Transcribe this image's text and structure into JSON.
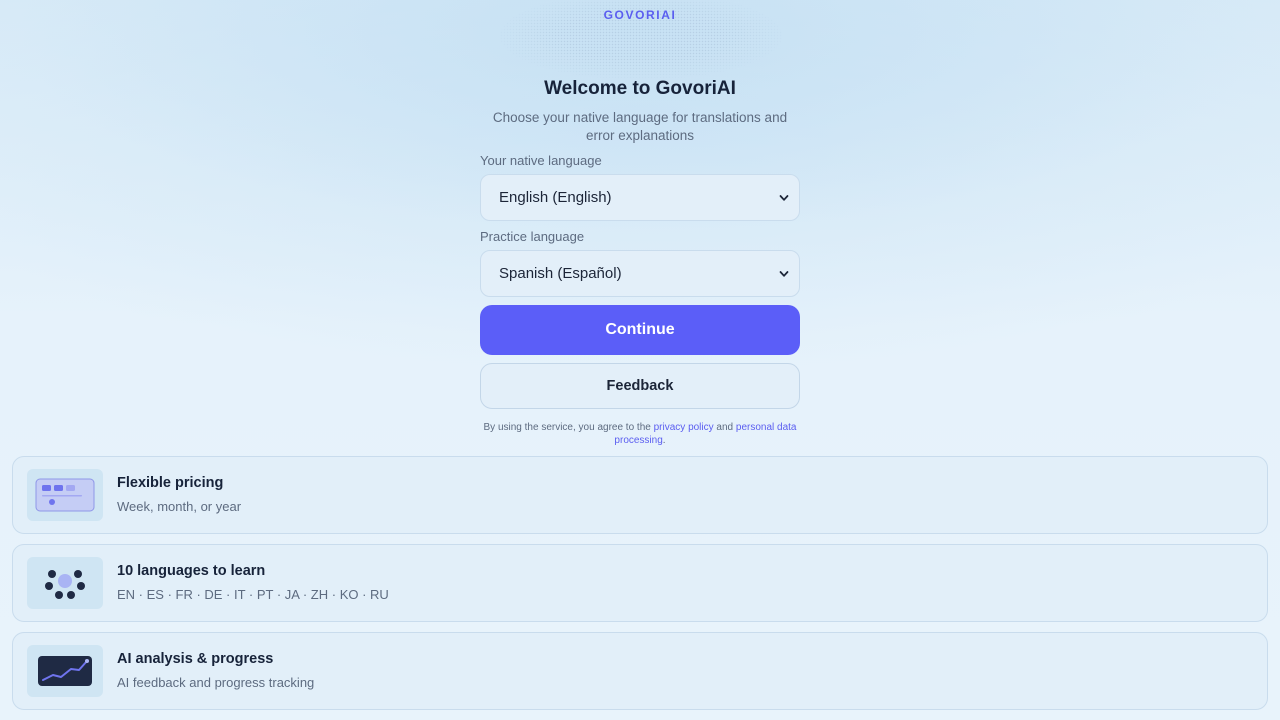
{
  "brand": "GOVORIAI",
  "welcome": {
    "title": "Welcome to GovoriAI",
    "subtitle": "Choose your native language for translations and error explanations"
  },
  "form": {
    "native_label": "Your native language",
    "native_value": "English (English)",
    "practice_label": "Practice language",
    "practice_value": "Spanish (Español)",
    "continue_label": "Continue",
    "feedback_label": "Feedback"
  },
  "legal": {
    "prefix": "By using the service, you agree to the",
    "privacy_link": "privacy policy",
    "and": "and",
    "data_link": "personal data processing",
    "suffix": "."
  },
  "features": [
    {
      "title": "Flexible pricing",
      "desc": "Week, month, or year",
      "icon": "pricing-cards-icon"
    },
    {
      "title": "10 languages to learn",
      "desc": "EN · ES · FR · DE · IT · PT · JA · ZH · KO · RU",
      "icon": "languages-globe-icon"
    },
    {
      "title": "AI analysis & progress",
      "desc": "AI feedback and progress tracking",
      "icon": "progress-chart-icon"
    }
  ],
  "colors": {
    "accent": "#5b5ef8",
    "background": "#e6f2fb",
    "text": "#17233a",
    "muted": "#5d6b80"
  }
}
